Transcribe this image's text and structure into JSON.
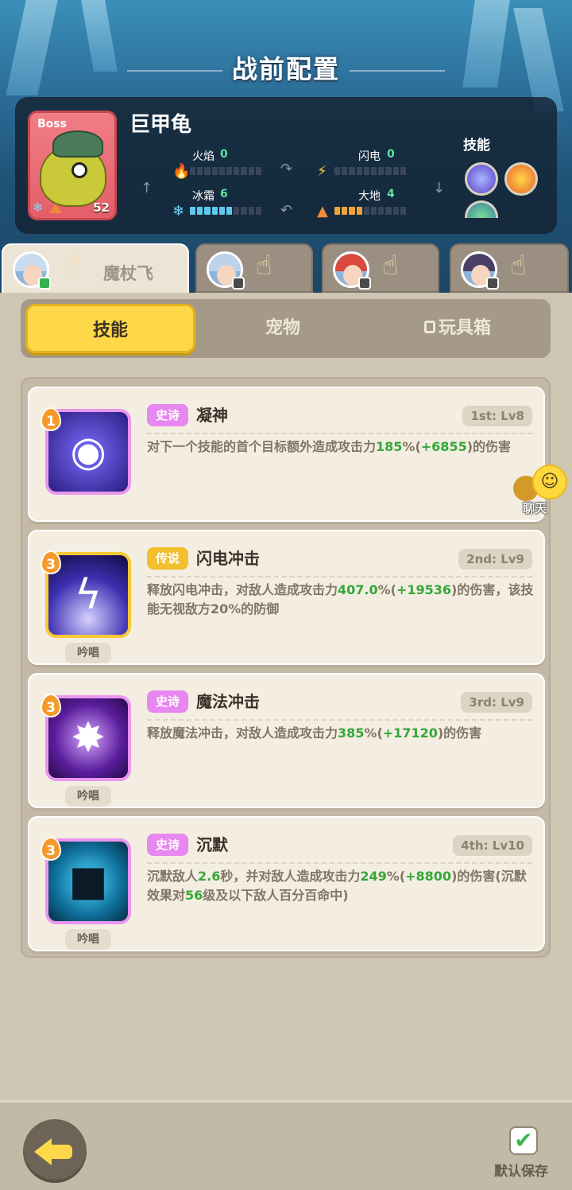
{
  "page_title": "战前配置",
  "boss": {
    "tag": "Boss",
    "name": "巨甲龟",
    "level": "52",
    "skills_label": "技能",
    "attributes": [
      {
        "label": "火焰",
        "value": "0",
        "icon": "fire-icon",
        "fill": 0
      },
      {
        "label": "闪电",
        "value": "0",
        "icon": "lightning-icon",
        "fill": 0
      },
      {
        "label": "冰霜",
        "value": "6",
        "icon": "snowflake-icon",
        "fill": 6
      },
      {
        "label": "大地",
        "value": "4",
        "icon": "earth-icon",
        "fill": 4
      }
    ]
  },
  "heroes": [
    {
      "name": "魔杖飞",
      "active": true
    },
    {
      "name": "",
      "active": false
    },
    {
      "name": "",
      "active": false
    },
    {
      "name": "",
      "active": false
    }
  ],
  "categories": {
    "skills": "技能",
    "pets": "宠物",
    "toybox": "玩具箱"
  },
  "skills": [
    {
      "rank": "1",
      "rarity": "史诗",
      "name": "凝神",
      "level": "1st: Lv8",
      "desc": [
        {
          "t": "对下一个技能的首个目标额外造成攻击力"
        },
        {
          "t": "185",
          "hl": true
        },
        {
          "t": "%("
        },
        {
          "t": "+6855",
          "hl": true
        },
        {
          "t": ")的伤害"
        }
      ],
      "chant": ""
    },
    {
      "rank": "3",
      "rarity": "传说",
      "name": "闪电冲击",
      "level": "2nd: Lv9",
      "desc": [
        {
          "t": "释放闪电冲击，对敌人造成攻击力"
        },
        {
          "t": "407.0",
          "hl": true
        },
        {
          "t": "%("
        },
        {
          "t": "+19536",
          "hl": true
        },
        {
          "t": ")的伤害，该技能无视敌方20%的防御"
        }
      ],
      "chant": "吟唱"
    },
    {
      "rank": "3",
      "rarity": "史诗",
      "name": "魔法冲击",
      "level": "3rd: Lv9",
      "desc": [
        {
          "t": "释放魔法冲击，对敌人造成攻击力"
        },
        {
          "t": "385",
          "hl": true
        },
        {
          "t": "%("
        },
        {
          "t": "+17120",
          "hl": true
        },
        {
          "t": ")的伤害"
        }
      ],
      "chant": "吟唱"
    },
    {
      "rank": "3",
      "rarity": "史诗",
      "name": "沉默",
      "level": "4th: Lv10",
      "desc": [
        {
          "t": "沉默敌人"
        },
        {
          "t": "2.6",
          "hl": true
        },
        {
          "t": "秒，并对敌人造成攻击力"
        },
        {
          "t": "249",
          "hl": true
        },
        {
          "t": "%("
        },
        {
          "t": "+8800",
          "hl": true
        },
        {
          "t": ")的伤害(沉默效果对"
        },
        {
          "t": "56",
          "hl": true
        },
        {
          "t": "级及以下敌人百分百命中)"
        }
      ],
      "chant": "吟唱"
    }
  ],
  "chat_label": "聊天",
  "save_label": "默认保存",
  "colors": {
    "accent_yellow": "#ffd84a",
    "epic": "#e787f0",
    "legend": "#f2c02c",
    "highlight_green": "#34a83a"
  }
}
